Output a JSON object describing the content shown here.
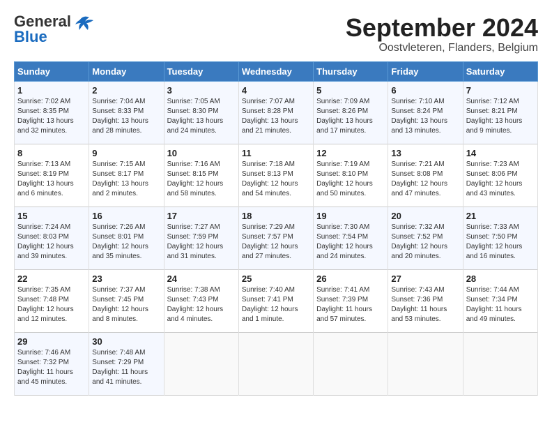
{
  "header": {
    "logo_general": "General",
    "logo_blue": "Blue",
    "month_title": "September 2024",
    "location": "Oostvleteren, Flanders, Belgium"
  },
  "days_of_week": [
    "Sunday",
    "Monday",
    "Tuesday",
    "Wednesday",
    "Thursday",
    "Friday",
    "Saturday"
  ],
  "weeks": [
    [
      {
        "day": "1",
        "info": "Sunrise: 7:02 AM\nSunset: 8:35 PM\nDaylight: 13 hours\nand 32 minutes."
      },
      {
        "day": "2",
        "info": "Sunrise: 7:04 AM\nSunset: 8:33 PM\nDaylight: 13 hours\nand 28 minutes."
      },
      {
        "day": "3",
        "info": "Sunrise: 7:05 AM\nSunset: 8:30 PM\nDaylight: 13 hours\nand 24 minutes."
      },
      {
        "day": "4",
        "info": "Sunrise: 7:07 AM\nSunset: 8:28 PM\nDaylight: 13 hours\nand 21 minutes."
      },
      {
        "day": "5",
        "info": "Sunrise: 7:09 AM\nSunset: 8:26 PM\nDaylight: 13 hours\nand 17 minutes."
      },
      {
        "day": "6",
        "info": "Sunrise: 7:10 AM\nSunset: 8:24 PM\nDaylight: 13 hours\nand 13 minutes."
      },
      {
        "day": "7",
        "info": "Sunrise: 7:12 AM\nSunset: 8:21 PM\nDaylight: 13 hours\nand 9 minutes."
      }
    ],
    [
      {
        "day": "8",
        "info": "Sunrise: 7:13 AM\nSunset: 8:19 PM\nDaylight: 13 hours\nand 6 minutes."
      },
      {
        "day": "9",
        "info": "Sunrise: 7:15 AM\nSunset: 8:17 PM\nDaylight: 13 hours\nand 2 minutes."
      },
      {
        "day": "10",
        "info": "Sunrise: 7:16 AM\nSunset: 8:15 PM\nDaylight: 12 hours\nand 58 minutes."
      },
      {
        "day": "11",
        "info": "Sunrise: 7:18 AM\nSunset: 8:13 PM\nDaylight: 12 hours\nand 54 minutes."
      },
      {
        "day": "12",
        "info": "Sunrise: 7:19 AM\nSunset: 8:10 PM\nDaylight: 12 hours\nand 50 minutes."
      },
      {
        "day": "13",
        "info": "Sunrise: 7:21 AM\nSunset: 8:08 PM\nDaylight: 12 hours\nand 47 minutes."
      },
      {
        "day": "14",
        "info": "Sunrise: 7:23 AM\nSunset: 8:06 PM\nDaylight: 12 hours\nand 43 minutes."
      }
    ],
    [
      {
        "day": "15",
        "info": "Sunrise: 7:24 AM\nSunset: 8:03 PM\nDaylight: 12 hours\nand 39 minutes."
      },
      {
        "day": "16",
        "info": "Sunrise: 7:26 AM\nSunset: 8:01 PM\nDaylight: 12 hours\nand 35 minutes."
      },
      {
        "day": "17",
        "info": "Sunrise: 7:27 AM\nSunset: 7:59 PM\nDaylight: 12 hours\nand 31 minutes."
      },
      {
        "day": "18",
        "info": "Sunrise: 7:29 AM\nSunset: 7:57 PM\nDaylight: 12 hours\nand 27 minutes."
      },
      {
        "day": "19",
        "info": "Sunrise: 7:30 AM\nSunset: 7:54 PM\nDaylight: 12 hours\nand 24 minutes."
      },
      {
        "day": "20",
        "info": "Sunrise: 7:32 AM\nSunset: 7:52 PM\nDaylight: 12 hours\nand 20 minutes."
      },
      {
        "day": "21",
        "info": "Sunrise: 7:33 AM\nSunset: 7:50 PM\nDaylight: 12 hours\nand 16 minutes."
      }
    ],
    [
      {
        "day": "22",
        "info": "Sunrise: 7:35 AM\nSunset: 7:48 PM\nDaylight: 12 hours\nand 12 minutes."
      },
      {
        "day": "23",
        "info": "Sunrise: 7:37 AM\nSunset: 7:45 PM\nDaylight: 12 hours\nand 8 minutes."
      },
      {
        "day": "24",
        "info": "Sunrise: 7:38 AM\nSunset: 7:43 PM\nDaylight: 12 hours\nand 4 minutes."
      },
      {
        "day": "25",
        "info": "Sunrise: 7:40 AM\nSunset: 7:41 PM\nDaylight: 12 hours\nand 1 minute."
      },
      {
        "day": "26",
        "info": "Sunrise: 7:41 AM\nSunset: 7:39 PM\nDaylight: 11 hours\nand 57 minutes."
      },
      {
        "day": "27",
        "info": "Sunrise: 7:43 AM\nSunset: 7:36 PM\nDaylight: 11 hours\nand 53 minutes."
      },
      {
        "day": "28",
        "info": "Sunrise: 7:44 AM\nSunset: 7:34 PM\nDaylight: 11 hours\nand 49 minutes."
      }
    ],
    [
      {
        "day": "29",
        "info": "Sunrise: 7:46 AM\nSunset: 7:32 PM\nDaylight: 11 hours\nand 45 minutes."
      },
      {
        "day": "30",
        "info": "Sunrise: 7:48 AM\nSunset: 7:29 PM\nDaylight: 11 hours\nand 41 minutes."
      },
      {
        "day": "",
        "info": ""
      },
      {
        "day": "",
        "info": ""
      },
      {
        "day": "",
        "info": ""
      },
      {
        "day": "",
        "info": ""
      },
      {
        "day": "",
        "info": ""
      }
    ]
  ]
}
